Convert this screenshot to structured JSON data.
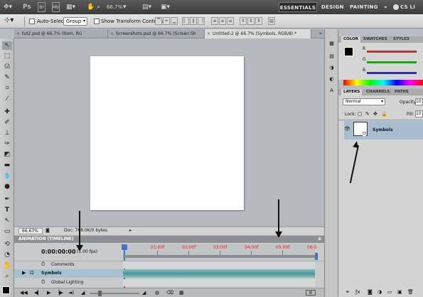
{
  "app": {
    "logo": "Ps",
    "zoom": "66.7%",
    "workspaces": [
      "ESSENTIALS",
      "DESIGN",
      "PAINTING",
      "CS Li"
    ],
    "icons": [
      "bridge-icon",
      "mini-bridge-icon",
      "view-extras-icon"
    ]
  },
  "options": {
    "auto_select_label": "Auto-Select:",
    "auto_select_value": "Group",
    "transform_label": "Show Transform Controls"
  },
  "tabs": [
    {
      "label": "tut2.psd @ 66.7% (Item, RG"
    },
    {
      "label": "Screenshots.psd @ 66.7% (Screen Sh"
    },
    {
      "label": "Untitled-2 @ 66.7% (Symbols, RGB/8) *"
    }
  ],
  "status": {
    "zoom": "66.67%",
    "doc": "Doc: 768.0K/0 bytes"
  },
  "timeline": {
    "title": "ANIMATION (TIMELINE)",
    "time": "0:00:00:00",
    "fps": "(1.00 fps)",
    "ticks": [
      "01:00f",
      "02:00f",
      "03:00f",
      "04:00f",
      "05:00f",
      "06:0"
    ],
    "rows": [
      "Comments",
      "Symbols",
      "Global Lighting"
    ]
  },
  "color_panel": {
    "tabs": [
      "COLOR",
      "SWATCHES",
      "STYLES"
    ],
    "channels": [
      "R",
      "G",
      "B"
    ],
    "colors": {
      "r": "#d42a2a",
      "g": "#2a9a2a",
      "b": "#2a2ad4"
    }
  },
  "layers_panel": {
    "tabs": [
      "LAYERS",
      "CHANNELS",
      "PATHS"
    ],
    "blend_mode": "Normal",
    "opacity_label": "Opacity:",
    "opacity_value": "10",
    "lock_label": "Lock:",
    "fill_label": "Fill:",
    "fill_value": "10",
    "layer_name": "Symbols"
  }
}
